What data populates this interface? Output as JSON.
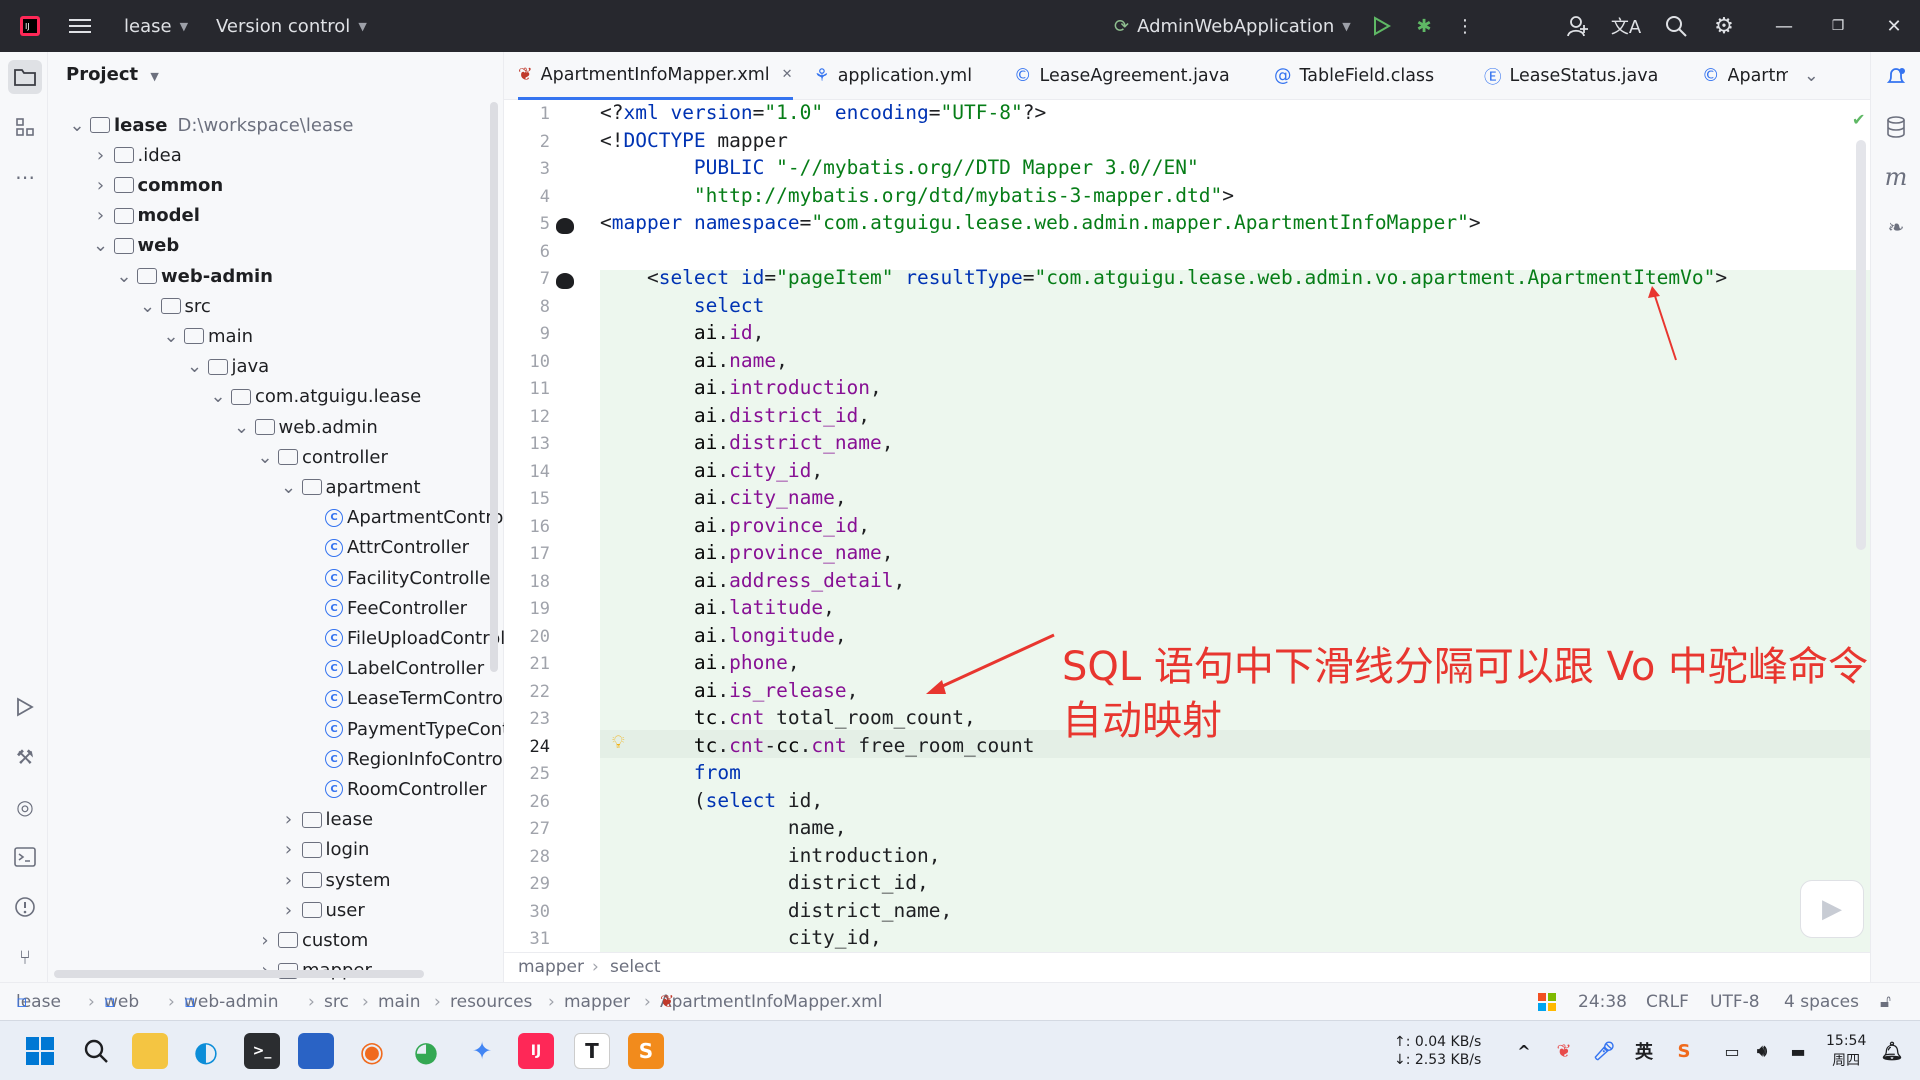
{
  "titlebar": {
    "project_name": "lease",
    "vcs_label": "Version control",
    "run_config": "AdminWebApplication"
  },
  "project_panel": {
    "title": "Project",
    "root_name": "lease",
    "root_path": "D:\\workspace\\lease",
    "items": [
      {
        "label": "lease",
        "kind": "module"
      },
      {
        "label": ".idea",
        "kind": "folder"
      },
      {
        "label": "common",
        "kind": "module"
      },
      {
        "label": "model",
        "kind": "module"
      },
      {
        "label": "web",
        "kind": "module"
      },
      {
        "label": "web-admin",
        "kind": "module"
      },
      {
        "label": "src",
        "kind": "folder"
      },
      {
        "label": "main",
        "kind": "folder"
      },
      {
        "label": "java",
        "kind": "folder"
      },
      {
        "label": "com.atguigu.lease",
        "kind": "package"
      },
      {
        "label": "web.admin",
        "kind": "package"
      },
      {
        "label": "controller",
        "kind": "package"
      },
      {
        "label": "apartment",
        "kind": "package"
      },
      {
        "label": "ApartmentControll",
        "kind": "class"
      },
      {
        "label": "AttrController",
        "kind": "class"
      },
      {
        "label": "FacilityController",
        "kind": "class"
      },
      {
        "label": "FeeController",
        "kind": "class"
      },
      {
        "label": "FileUploadControll",
        "kind": "class"
      },
      {
        "label": "LabelController",
        "kind": "class"
      },
      {
        "label": "LeaseTermControl",
        "kind": "class"
      },
      {
        "label": "PaymentTypeCont",
        "kind": "class"
      },
      {
        "label": "RegionInfoControll",
        "kind": "class"
      },
      {
        "label": "RoomController",
        "kind": "class"
      },
      {
        "label": "lease",
        "kind": "package"
      },
      {
        "label": "login",
        "kind": "package"
      },
      {
        "label": "system",
        "kind": "package"
      },
      {
        "label": "user",
        "kind": "package"
      },
      {
        "label": "custom",
        "kind": "package"
      },
      {
        "label": "mapper",
        "kind": "package"
      }
    ]
  },
  "tabs": [
    {
      "label": "ApartmentInfoMapper.xml",
      "active": true
    },
    {
      "label": "application.yml",
      "active": false
    },
    {
      "label": "LeaseAgreement.java",
      "active": false
    },
    {
      "label": "TableField.class",
      "active": false
    },
    {
      "label": "LeaseStatus.java",
      "active": false
    },
    {
      "label": "Apartm",
      "active": false
    }
  ],
  "editor": {
    "lines": [
      {
        "n": "1",
        "text": "<?xml version=\"1.0\" encoding=\"UTF-8\"?>"
      },
      {
        "n": "2",
        "text": "<!DOCTYPE mapper"
      },
      {
        "n": "3",
        "text": "        PUBLIC \"-//mybatis.org//DTD Mapper 3.0//EN\""
      },
      {
        "n": "4",
        "text": "        \"http://mybatis.org/dtd/mybatis-3-mapper.dtd\">"
      },
      {
        "n": "5",
        "text": "<mapper namespace=\"com.atguigu.lease.web.admin.mapper.ApartmentInfoMapper\">"
      },
      {
        "n": "6",
        "text": ""
      },
      {
        "n": "7",
        "text": "    <select id=\"pageItem\" resultType=\"com.atguigu.lease.web.admin.vo.apartment.ApartmentItemVo\">"
      },
      {
        "n": "8",
        "text": "        select"
      },
      {
        "n": "9",
        "text": "        ai.id,"
      },
      {
        "n": "10",
        "text": "        ai.name,"
      },
      {
        "n": "11",
        "text": "        ai.introduction,"
      },
      {
        "n": "12",
        "text": "        ai.district_id,"
      },
      {
        "n": "13",
        "text": "        ai.district_name,"
      },
      {
        "n": "14",
        "text": "        ai.city_id,"
      },
      {
        "n": "15",
        "text": "        ai.city_name,"
      },
      {
        "n": "16",
        "text": "        ai.province_id,"
      },
      {
        "n": "17",
        "text": "        ai.province_name,"
      },
      {
        "n": "18",
        "text": "        ai.address_detail,"
      },
      {
        "n": "19",
        "text": "        ai.latitude,"
      },
      {
        "n": "20",
        "text": "        ai.longitude,"
      },
      {
        "n": "21",
        "text": "        ai.phone,"
      },
      {
        "n": "22",
        "text": "        ai.is_release,"
      },
      {
        "n": "23",
        "text": "        tc.cnt total_room_count,"
      },
      {
        "n": "24",
        "text": "        tc.cnt-cc.cnt free_room_count"
      },
      {
        "n": "25",
        "text": "        from"
      },
      {
        "n": "26",
        "text": "        (select id,"
      },
      {
        "n": "27",
        "text": "                name,"
      },
      {
        "n": "28",
        "text": "                introduction,"
      },
      {
        "n": "29",
        "text": "                district_id,"
      },
      {
        "n": "30",
        "text": "                district_name,"
      },
      {
        "n": "31",
        "text": "                city_id,"
      }
    ]
  },
  "annotation": {
    "line1": "SQL 语句中下滑线分隔可以跟 Vo 中驼峰命令",
    "line2": "自动映射"
  },
  "breadcrumb_editor": [
    "mapper",
    "select"
  ],
  "breadcrumb_nav": [
    "lease",
    "web",
    "web-admin",
    "src",
    "main",
    "resources",
    "mapper",
    "ApartmentInfoMapper.xml"
  ],
  "status": {
    "position": "24:38",
    "line_sep": "CRLF",
    "encoding": "UTF-8",
    "indent": "4 spaces"
  },
  "taskbar": {
    "net_up": "↑: 0.04 KB/s",
    "net_down": "↓: 2.53 KB/s",
    "time": "15:54",
    "day": "周四"
  },
  "colors": {
    "accent": "#3574f0",
    "annotation": "#e8362f",
    "highlight": "#edf7ee"
  }
}
